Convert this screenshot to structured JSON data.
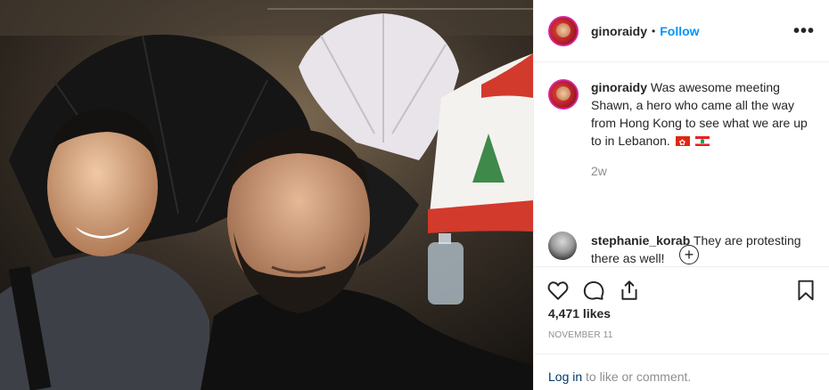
{
  "post": {
    "username": "ginoraidy",
    "follow_label": "Follow",
    "separator": "•",
    "more_icon": "more-options-icon",
    "caption_text": "Was awesome meeting Shawn, a hero who came all the way from Hong Kong to see what we are up to in Lebanon.",
    "caption_flags": [
      "hong-kong-flag-icon",
      "lebanon-flag-icon"
    ],
    "time_ago": "2w",
    "load_more_icon": "plus-circle-icon",
    "comments": [
      {
        "username": "stephanie_korab",
        "text": "They are protesting there as well!"
      }
    ],
    "likes": "4,471 likes",
    "date": "NOVEMBER 11",
    "login_link": "Log in",
    "login_suffix": " to like or comment.",
    "action_icons": [
      "heart-icon",
      "comment-icon",
      "share-icon",
      "bookmark-icon"
    ]
  },
  "colors": {
    "follow_blue": "#0095f6",
    "muted_gray": "#8e8e8e",
    "link_navy": "#00376b",
    "border": "#efefef",
    "avatar_ring": "#d6249f"
  }
}
